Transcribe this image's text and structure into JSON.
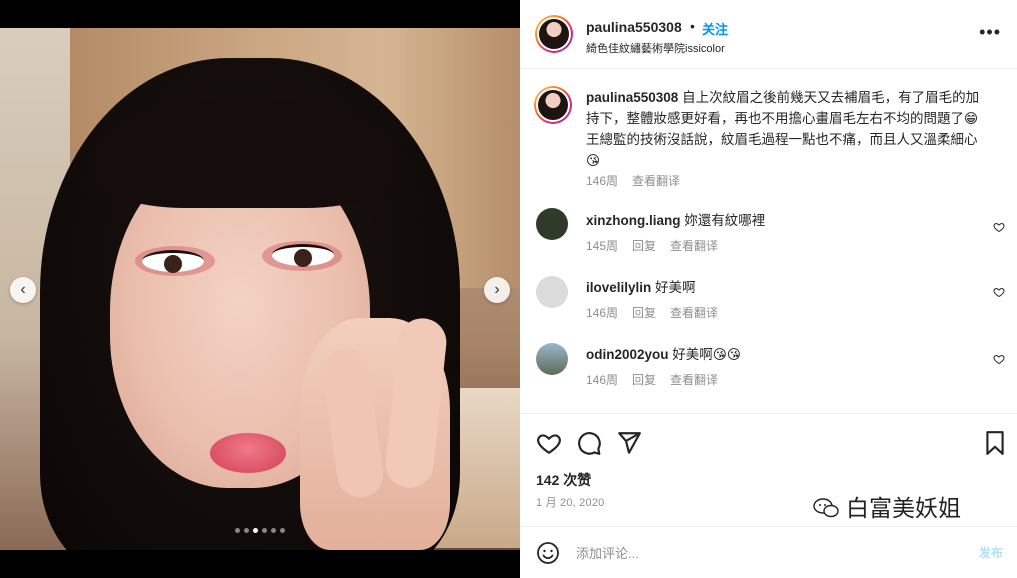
{
  "post": {
    "username": "paulina550308",
    "follow_label": "关注",
    "separator": "•",
    "location": "綺色佳紋繡藝術學院issicolor",
    "more_icon": "more-horizontal-icon"
  },
  "media": {
    "image_subject": "selfie",
    "nav_prev_icon": "chevron-left-icon",
    "nav_next_icon": "chevron-right-icon",
    "dots_count": 6,
    "active_dot": 3
  },
  "caption": {
    "username": "paulina550308",
    "text": " 自上次紋眉之後前幾天又去補眉毛，有了眉毛的加持下，整體妝感更好看，再也不用擔心畫眉毛左右不均的問題了😁王總監的技術沒話說，紋眉毛過程一點也不痛，而且人又溫柔細心😘",
    "time": "146周",
    "translate": "查看翻译"
  },
  "comments": [
    {
      "username": "xinzhong.liang",
      "text": " 妳還有紋哪裡",
      "time": "145周",
      "reply": "回复",
      "translate": "查看翻译",
      "avatar_color": "#2f3a2a"
    },
    {
      "username": "ilovelilylin",
      "text": " 好美啊",
      "time": "146周",
      "reply": "回复",
      "translate": "查看翻译",
      "avatar_color": "#dbdbdb"
    },
    {
      "username": "odin2002you",
      "text": " 好美啊😘😘",
      "time": "146周",
      "reply": "回复",
      "translate": "查看翻译",
      "avatar_color": "#6b7d8a"
    }
  ],
  "actions": {
    "like_icon": "heart-icon",
    "comment_icon": "comment-icon",
    "share_icon": "send-icon",
    "save_icon": "bookmark-icon",
    "likes": "142 次赞",
    "date": "1 月 20, 2020"
  },
  "add_comment": {
    "emoji_icon": "smiley-icon",
    "placeholder": "添加评论...",
    "post_label": "发布"
  },
  "watermark": {
    "text": "白富美妖姐",
    "icon": "wechat-icon"
  },
  "colors": {
    "accent": "#0095f6",
    "text": "#262626",
    "muted": "#8e8e8e",
    "post_disabled": "#b2dffc"
  }
}
